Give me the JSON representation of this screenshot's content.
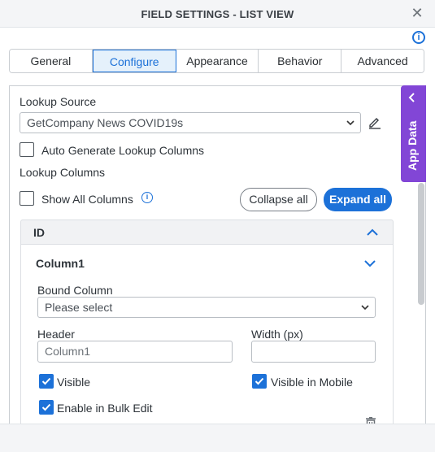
{
  "dialog": {
    "title": "FIELD SETTINGS - LIST VIEW",
    "close_glyph": "✕"
  },
  "tabs": [
    {
      "label": "General"
    },
    {
      "label": "Configure"
    },
    {
      "label": "Appearance"
    },
    {
      "label": "Behavior"
    },
    {
      "label": "Advanced"
    }
  ],
  "active_tab": "Configure",
  "configure": {
    "lookup_source_label": "Lookup Source",
    "lookup_source_value": "GetCompany News COVID19s",
    "auto_generate_label": "Auto Generate Lookup Columns",
    "lookup_columns_label": "Lookup Columns",
    "show_all_columns_label": "Show All Columns",
    "collapse_all_label": "Collapse all",
    "expand_all_label": "Expand all"
  },
  "accordion": {
    "group_label": "ID",
    "column_label": "Column1",
    "bound_column_label": "Bound Column",
    "bound_column_placeholder": "Please select",
    "header_label": "Header",
    "header_value": "Column1",
    "width_label": "Width (px)",
    "width_value": "",
    "visible_label": "Visible",
    "visible_mobile_label": "Visible in Mobile",
    "bulk_edit_label": "Enable in Bulk Edit"
  },
  "side_tab": {
    "label": "App Data"
  },
  "colors": {
    "accent": "#1c71d8",
    "side_tab": "#8246d6"
  }
}
